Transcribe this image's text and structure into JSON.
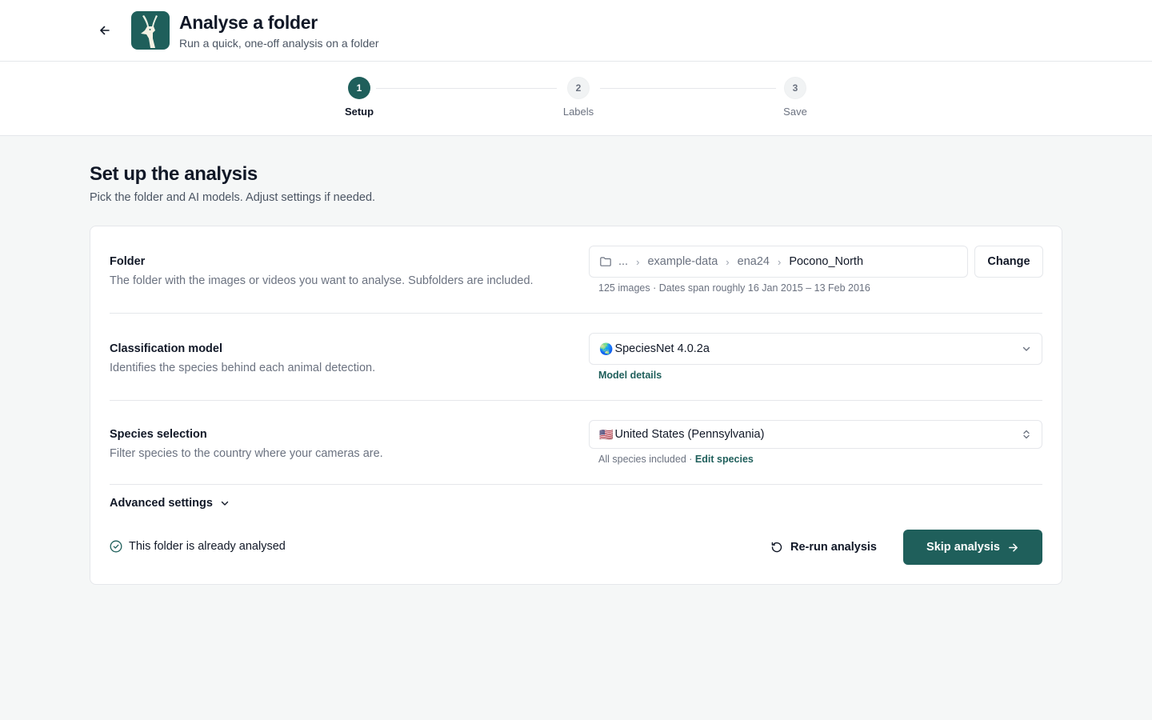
{
  "header": {
    "title": "Analyse a folder",
    "subtitle": "Run a quick, one-off analysis on a folder",
    "back_icon": "arrow-left-icon",
    "logo_icon": "gazelle-logo",
    "brand_color": "#1f5f5b"
  },
  "stepper": {
    "steps": [
      {
        "number": "1",
        "label": "Setup",
        "state": "active"
      },
      {
        "number": "2",
        "label": "Labels",
        "state": "inactive"
      },
      {
        "number": "3",
        "label": "Save",
        "state": "inactive"
      }
    ]
  },
  "page": {
    "title": "Set up the analysis",
    "subtitle": "Pick the folder and AI models. Adjust settings if needed."
  },
  "folder": {
    "label": "Folder",
    "description": "The folder with the images or videos you want to analyse. Subfolders are included.",
    "path": [
      "...",
      "example-data",
      "ena24",
      "Pocono_North"
    ],
    "change_label": "Change",
    "meta": "125 images · Dates span roughly 16 Jan 2015 – 13 Feb 2016"
  },
  "classification": {
    "label": "Classification model",
    "description": "Identifies the species behind each animal detection.",
    "emoji": "🌏",
    "value": "SpeciesNet 4.0.2a",
    "details_link": "Model details"
  },
  "species": {
    "label": "Species selection",
    "description": "Filter species to the country where your cameras are.",
    "emoji": "🇺🇸",
    "value": "United States (Pennsylvania)",
    "meta": "All species included · ",
    "edit_link": "Edit species"
  },
  "advanced": {
    "label": "Advanced settings"
  },
  "footer": {
    "status": "This folder is already analysed",
    "rerun_label": "Re-run analysis",
    "skip_label": "Skip analysis"
  }
}
